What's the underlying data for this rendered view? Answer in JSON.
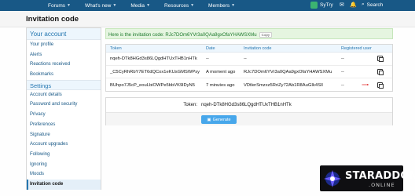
{
  "nav": {
    "items": [
      {
        "label": "Forums",
        "has_chevron": true
      },
      {
        "label": "What's new",
        "has_chevron": true
      },
      {
        "label": "Media",
        "has_chevron": true
      },
      {
        "label": "Resources",
        "has_chevron": true
      },
      {
        "label": "Members",
        "has_chevron": true
      }
    ],
    "user_name": "SyTry",
    "search_label": "Search"
  },
  "page": {
    "title": "Invitation code"
  },
  "sidebar": {
    "account_heading": "Your account",
    "account_items": [
      "Your profile",
      "Alerts",
      "Reactions received",
      "Bookmarks"
    ],
    "settings_heading": "Settings",
    "settings_items": [
      "Account details",
      "Password and security",
      "Privacy",
      "Preferences",
      "Signature",
      "Account upgrades",
      "Following",
      "Ignoring",
      "Moods",
      "Invitation code"
    ],
    "active_item": "Invitation code"
  },
  "notice": {
    "text": "Here is the invitation code: RJc7DOm6YVr3a0QAa9gxOfaYHAWSXMu",
    "copy_label": "Copy"
  },
  "table": {
    "headers": [
      "Token",
      "Date",
      "Invitation code",
      "Registered user"
    ],
    "rows": [
      {
        "token": "nqeh-DTk8HGd3s86LQgdHTUxTHB1nHTk",
        "date": "--",
        "invitation_code": "--",
        "registered_user": "--"
      },
      {
        "token": "_C5CyRhRbY7ET6dQCox1eKUsGMSWPsy",
        "date": "A moment ago",
        "invitation_code": "RJc7DOm6YVr3a0QAa9gxOfaYHAWSXMu",
        "registered_user": "--"
      },
      {
        "token": "BUhpo7J5cP_eouLbiOWPe5bbVK9lDyN5",
        "date": "7 minutes ago",
        "invitation_code": "VDtlerSmzxz5RriZy72Ab1R8AuGIk4SIl",
        "registered_user": "--"
      }
    ]
  },
  "form": {
    "token_label": "Token:",
    "token_value": "nqeh-DTk8HGd3s86LQgdHTUxTHB1nHTk",
    "generate_label": "Generate"
  },
  "watermark": {
    "line1": "STARADDONS",
    "line2": ".ONLINE"
  },
  "colors": {
    "nav_bg": "#185886",
    "accent": "#2577b1",
    "button": "#47a7eb",
    "success_bg": "#e5f5e0",
    "arrow": "#e02020"
  }
}
